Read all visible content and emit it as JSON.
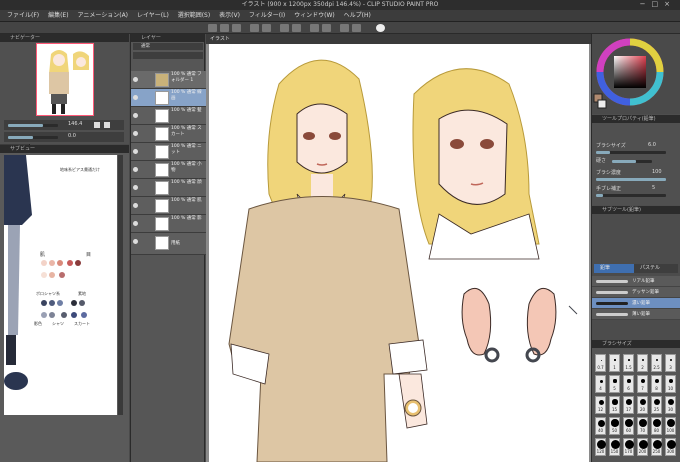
{
  "window": {
    "title": "イラスト (900 x 1200px 350dpi 146.4%) - CLIP STUDIO PAINT PRO"
  },
  "menu": [
    "ファイル(F)",
    "編集(E)",
    "アニメーション(A)",
    "レイヤー(L)",
    "選択範囲(S)",
    "表示(V)",
    "フィルター(I)",
    "ウィンドウ(W)",
    "ヘルプ(H)"
  ],
  "navigator": {
    "title": "ナビゲーター",
    "zoom": "146.4",
    "rotate": "0.0"
  },
  "subview": {
    "title": "サブビュー",
    "notes": [
      "地味系ピアス貫通だけ",
      "肌",
      "目",
      "ポロシャツ系",
      "素地",
      "影色",
      "シャツ",
      "スカート"
    ]
  },
  "layers": {
    "title": "レイヤー",
    "blend": "通常",
    "items": [
      {
        "name": "100 % 通常 フォルダー 1"
      },
      {
        "name": "100 % 通常 線画"
      },
      {
        "name": "100 % 通常 髪"
      },
      {
        "name": "100 % 通常 スカート"
      },
      {
        "name": "100 % 通常 ニット"
      },
      {
        "name": "100 % 通常 小物"
      },
      {
        "name": "100 % 通常 顔"
      },
      {
        "name": "100 % 通常 肌"
      },
      {
        "name": "100 % 通常 影"
      },
      {
        "name": "用紙"
      }
    ]
  },
  "canvas": {
    "tab": "イラスト"
  },
  "tool_property": {
    "title": "ツールプロパティ(鉛筆)",
    "brush_size_label": "ブラシサイズ",
    "brush_size": "6.0",
    "hardness_label": "硬さ",
    "density_label": "ブラシ濃度",
    "density": "100",
    "stabilize_label": "手ブレ補正",
    "stabilize": "5"
  },
  "subtool": {
    "title": "サブツール(鉛筆)",
    "tabs": [
      "鉛筆",
      "パステル"
    ],
    "brushes": [
      "リアル鉛筆",
      "デッサン鉛筆",
      "濃い鉛筆",
      "薄い鉛筆"
    ]
  },
  "brush_size_panel": {
    "title": "ブラシサイズ",
    "sizes": [
      "0.7",
      "1",
      "1.5",
      "2",
      "2.5",
      "3",
      "4",
      "5",
      "6",
      "7",
      "8",
      "10",
      "12",
      "15",
      "17",
      "20",
      "25",
      "30",
      "40",
      "50",
      "60",
      "70",
      "80",
      "100",
      "120",
      "150",
      "170",
      "200",
      "250",
      "300"
    ]
  },
  "colors": {
    "hair": "#f0d57a",
    "skin": "#fbe8de",
    "sweater": "#ddc6a4",
    "line": "#3b2a26",
    "accent": "#ff5a78"
  }
}
